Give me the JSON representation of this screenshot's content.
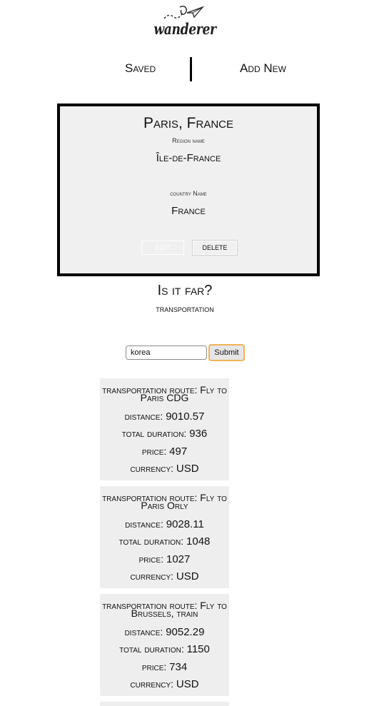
{
  "brand": {
    "name": "wanderer"
  },
  "nav": {
    "saved": "Saved",
    "add_new": "Add New"
  },
  "location": {
    "title": "Paris, France",
    "region_label": "Region name",
    "region_value": "Île-de-France",
    "country_label": "country Name",
    "country_value": "France",
    "edit_label": "EDIT",
    "delete_label": "DELETE"
  },
  "section": {
    "heading": "Is it far?",
    "subheading": "transportation"
  },
  "search": {
    "value": "korea",
    "submit_label": "Submit"
  },
  "labels": {
    "route": "transportation route:",
    "distance": "distance:",
    "duration": "total duration:",
    "price": "price:",
    "currency": "currency:"
  },
  "results": [
    {
      "route": "Fly to Paris CDG",
      "distance": "9010.57",
      "duration": "936",
      "price": "497",
      "currency": "USD"
    },
    {
      "route": "Fly to Paris Orly",
      "distance": "9028.11",
      "duration": "1048",
      "price": "1027",
      "currency": "USD"
    },
    {
      "route": "Fly to Brussels, train",
      "distance": "9052.29",
      "duration": "1150",
      "price": "734",
      "currency": "USD"
    }
  ],
  "colors": {
    "card_bg": "#f0f0f0",
    "border": "#000000",
    "submit_border": "#f0b35a"
  }
}
